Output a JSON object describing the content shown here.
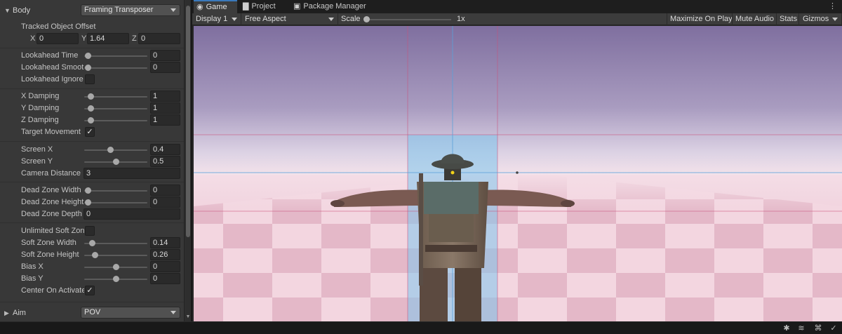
{
  "inspector": {
    "body": {
      "label": "Body",
      "value": "Framing Transposer"
    },
    "tracked_offset": {
      "label": "Tracked Object Offset",
      "x_label": "X",
      "x": "0",
      "y_label": "Y",
      "y": "1.64",
      "z_label": "Z",
      "z": "0"
    },
    "lookahead_time": {
      "label": "Lookahead Time",
      "value": "0",
      "level": 0
    },
    "lookahead_smoothing": {
      "label": "Lookahead Smooth",
      "value": "0",
      "level": 0
    },
    "lookahead_ignore_y": {
      "label": "Lookahead Ignore",
      "checked": false
    },
    "x_damping": {
      "label": "X Damping",
      "value": "1",
      "level": 0.05
    },
    "y_damping": {
      "label": "Y Damping",
      "value": "1",
      "level": 0.05
    },
    "z_damping": {
      "label": "Z Damping",
      "value": "1",
      "level": 0.05
    },
    "target_movement_only": {
      "label": "Target Movement",
      "check": "✓",
      "checked": true
    },
    "screen_x": {
      "label": "Screen X",
      "value": "0.4",
      "level": 0.4
    },
    "screen_y": {
      "label": "Screen Y",
      "value": "0.5",
      "level": 0.5
    },
    "camera_distance": {
      "label": "Camera Distance",
      "value": "3"
    },
    "dead_zone_width": {
      "label": "Dead Zone Width",
      "value": "0",
      "level": 0
    },
    "dead_zone_height": {
      "label": "Dead Zone Height",
      "value": "0",
      "level": 0
    },
    "dead_zone_depth": {
      "label": "Dead Zone Depth",
      "value": "0"
    },
    "unlimited_soft_zone": {
      "label": "Unlimited Soft Zon",
      "checked": false
    },
    "soft_zone_width": {
      "label": "Soft Zone Width",
      "value": "0.14",
      "level": 0.07
    },
    "soft_zone_height": {
      "label": "Soft Zone Height",
      "value": "0.26",
      "level": 0.13
    },
    "bias_x": {
      "label": "Bias X",
      "value": "0",
      "level": 0.5
    },
    "bias_y": {
      "label": "Bias Y",
      "value": "0",
      "level": 0.5
    },
    "center_on_activate": {
      "label": "Center On Activate",
      "check": "✓",
      "checked": true
    },
    "aim": {
      "label": "Aim",
      "value": "POV"
    }
  },
  "tabs": [
    {
      "label": "Game",
      "icon": "gamepad-icon",
      "glyph": "◉",
      "active": true
    },
    {
      "label": "Project",
      "icon": "folder-icon",
      "glyph": "▇",
      "active": false
    },
    {
      "label": "Package Manager",
      "icon": "package-icon",
      "glyph": "▣",
      "active": false
    }
  ],
  "game_toolbar": {
    "display": "Display 1",
    "aspect": "Free Aspect",
    "scale_label": "Scale",
    "scale_value": "1x",
    "scale_level": 0,
    "maximize": "Maximize On Play",
    "mute": "Mute Audio",
    "stats": "Stats",
    "gizmos": "Gizmos"
  },
  "colors": {
    "inspector_bg": "#383838",
    "field_bg": "#2a2a2a",
    "tab_accent": "#3a79bb",
    "sky_top": "#8a7aa8",
    "horizon": "#f1dbe6",
    "floor_light": "#f4d4df",
    "floor_dark": "#e3b9c8",
    "dead_zone": "#8fc8e8",
    "guide_red": "#c8507a",
    "guide_blue": "#5aa0d8",
    "target_marker": "#f2d21a"
  },
  "status_icons": [
    "bug-icon",
    "layers-icon",
    "debug-icon",
    "check-circle-icon"
  ]
}
